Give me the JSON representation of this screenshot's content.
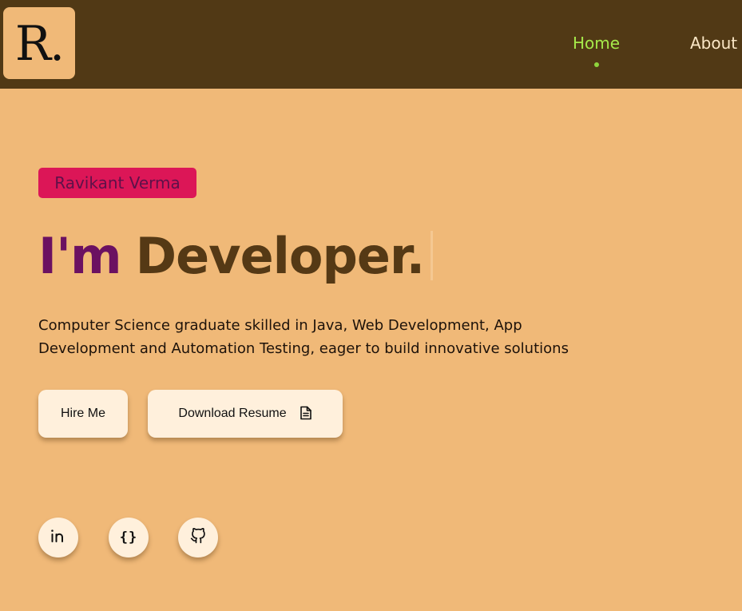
{
  "navbar": {
    "logo_text": "R.",
    "links": [
      {
        "label": "Home",
        "active": true
      },
      {
        "label": "About",
        "active": false
      }
    ]
  },
  "hero": {
    "name": "Ravikant Verma",
    "headline_prefix": "I'm",
    "headline_word": "Developer.",
    "intro": "Computer Science graduate skilled in Java, Web Development, App Development and Automation Testing, eager to build innovative solutions",
    "hire_label": "Hire Me",
    "resume_label": "Download Resume",
    "resume_icon": "document-icon"
  },
  "social": [
    {
      "name": "linkedin-icon"
    },
    {
      "name": "code-icon",
      "glyph": "{}"
    },
    {
      "name": "github-icon"
    }
  ],
  "colors": {
    "background": "#f0b978",
    "navbar": "#513915",
    "active_link": "#a6e94a",
    "badge": "#dc1657",
    "headline_prefix": "#6b1161",
    "headline_word": "#553915",
    "button": "#fff0dc"
  }
}
